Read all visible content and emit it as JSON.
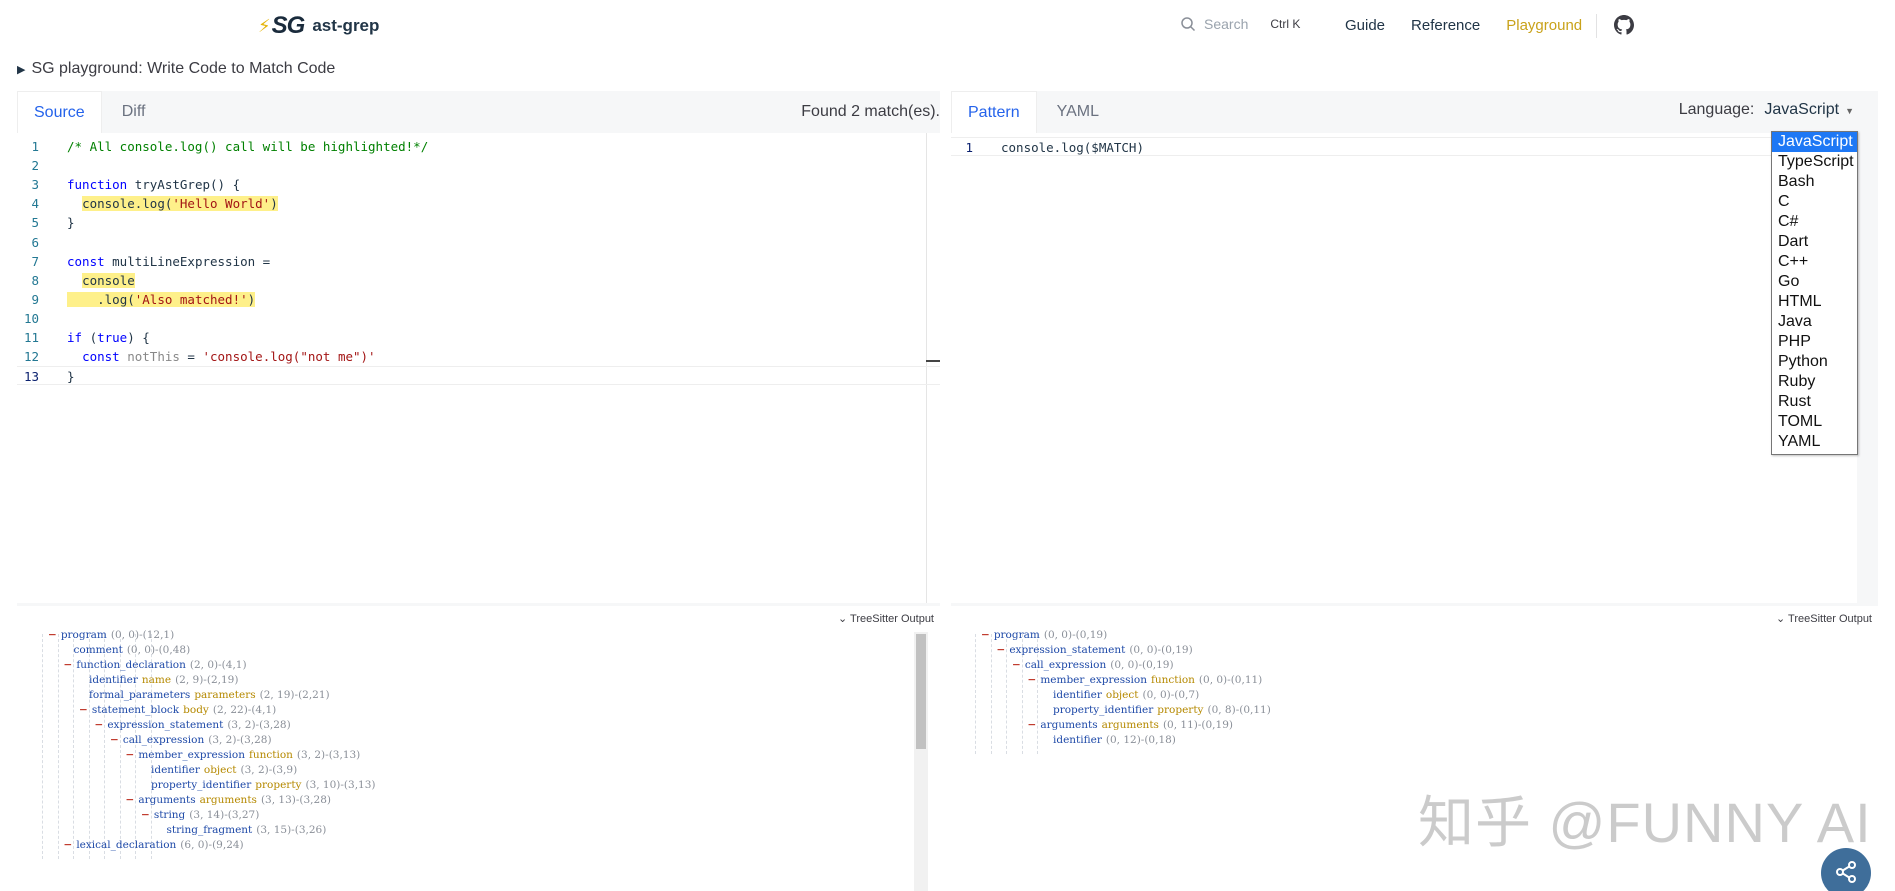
{
  "nav": {
    "logo_mark": "SG",
    "brand": "ast-grep",
    "search_placeholder": "Search",
    "search_shortcut": "Ctrl K",
    "links": [
      {
        "label": "Guide",
        "active": false
      },
      {
        "label": "Reference",
        "active": false
      },
      {
        "label": "Playground",
        "active": true
      }
    ],
    "github_icon": "github-icon"
  },
  "summary": "SG playground: Write Code to Match Code",
  "left": {
    "tabs": [
      "Source",
      "Diff"
    ],
    "active_tab": "Source",
    "found": "Found 2 match(es).",
    "lines": [
      {
        "n": "1",
        "tokens": [
          {
            "t": "/* All console.log() call will be highlighted!*/",
            "c": "comment"
          }
        ]
      },
      {
        "n": "2",
        "tokens": []
      },
      {
        "n": "3",
        "tokens": [
          {
            "t": "function ",
            "c": "kw"
          },
          {
            "t": "tryAstGrep() {",
            "c": "plain"
          }
        ]
      },
      {
        "n": "4",
        "tokens": [
          {
            "t": "  ",
            "c": "plain"
          },
          {
            "t": "console.log(",
            "c": "plain",
            "hl": true
          },
          {
            "t": "'Hello World'",
            "c": "str",
            "hl": true
          },
          {
            "t": ")",
            "c": "plain",
            "hl": true
          }
        ]
      },
      {
        "n": "5",
        "tokens": [
          {
            "t": "}",
            "c": "plain"
          }
        ]
      },
      {
        "n": "6",
        "tokens": []
      },
      {
        "n": "7",
        "tokens": [
          {
            "t": "const ",
            "c": "kw"
          },
          {
            "t": "multiLineExpression =",
            "c": "plain"
          }
        ]
      },
      {
        "n": "8",
        "tokens": [
          {
            "t": "  ",
            "c": "plain"
          },
          {
            "t": "console",
            "c": "plain",
            "hl": true
          }
        ]
      },
      {
        "n": "9",
        "tokens": [
          {
            "t": "  ",
            "c": "plain",
            "hl": true
          },
          {
            "t": "  .log(",
            "c": "plain",
            "hl": true
          },
          {
            "t": "'Also matched!'",
            "c": "str",
            "hl": true
          },
          {
            "t": ")",
            "c": "plain",
            "hl": true
          }
        ]
      },
      {
        "n": "10",
        "tokens": []
      },
      {
        "n": "11",
        "tokens": [
          {
            "t": "if ",
            "c": "kw"
          },
          {
            "t": "(",
            "c": "plain"
          },
          {
            "t": "true",
            "c": "kw"
          },
          {
            "t": ") {",
            "c": "plain"
          }
        ]
      },
      {
        "n": "12",
        "tokens": [
          {
            "t": "  ",
            "c": "plain"
          },
          {
            "t": "const ",
            "c": "kw"
          },
          {
            "t": "notThis",
            "c": "muted"
          },
          {
            "t": " = ",
            "c": "plain"
          },
          {
            "t": "'console.log(\"not me\")'",
            "c": "str"
          }
        ]
      },
      {
        "n": "13",
        "tokens": [
          {
            "t": "}",
            "c": "plain"
          }
        ]
      }
    ],
    "tree_title": "TreeSitter Output",
    "tree": [
      {
        "d": 0,
        "tog": "−",
        "kind": "program",
        "field": "",
        "range": "(0, 0)-(12,1)"
      },
      {
        "d": 1,
        "tog": "",
        "kind": "comment",
        "field": "",
        "range": "(0, 0)-(0,48)"
      },
      {
        "d": 1,
        "tog": "−",
        "kind": "function_declaration",
        "field": "",
        "range": "(2, 0)-(4,1)"
      },
      {
        "d": 2,
        "tog": "",
        "kind": "identifier",
        "field": "name",
        "range": "(2, 9)-(2,19)"
      },
      {
        "d": 2,
        "tog": "",
        "kind": "formal_parameters",
        "field": "parameters",
        "range": "(2, 19)-(2,21)"
      },
      {
        "d": 2,
        "tog": "−",
        "kind": "statement_block",
        "field": "body",
        "range": "(2, 22)-(4,1)"
      },
      {
        "d": 3,
        "tog": "−",
        "kind": "expression_statement",
        "field": "",
        "range": "(3, 2)-(3,28)"
      },
      {
        "d": 4,
        "tog": "−",
        "kind": "call_expression",
        "field": "",
        "range": "(3, 2)-(3,28)"
      },
      {
        "d": 5,
        "tog": "−",
        "kind": "member_expression",
        "field": "function",
        "range": "(3, 2)-(3,13)"
      },
      {
        "d": 6,
        "tog": "",
        "kind": "identifier",
        "field": "object",
        "range": "(3, 2)-(3,9)"
      },
      {
        "d": 6,
        "tog": "",
        "kind": "property_identifier",
        "field": "property",
        "range": "(3, 10)-(3,13)"
      },
      {
        "d": 5,
        "tog": "−",
        "kind": "arguments",
        "field": "arguments",
        "range": "(3, 13)-(3,28)"
      },
      {
        "d": 6,
        "tog": "−",
        "kind": "string",
        "field": "",
        "range": "(3, 14)-(3,27)"
      },
      {
        "d": 7,
        "tog": "",
        "kind": "string_fragment",
        "field": "",
        "range": "(3, 15)-(3,26)"
      },
      {
        "d": 1,
        "tog": "−",
        "kind": "lexical_declaration",
        "field": "",
        "range": "(6, 0)-(9,24)"
      }
    ]
  },
  "right": {
    "tabs": [
      "Pattern",
      "YAML"
    ],
    "active_tab": "Pattern",
    "language_label": "Language:",
    "language_value": "JavaScript",
    "lines": [
      {
        "n": "1",
        "tokens": [
          {
            "t": "console.log($MATCH)",
            "c": "plain"
          }
        ]
      }
    ],
    "tree_title": "TreeSitter Output",
    "tree": [
      {
        "d": 0,
        "tog": "−",
        "kind": "program",
        "field": "",
        "range": "(0, 0)-(0,19)"
      },
      {
        "d": 1,
        "tog": "−",
        "kind": "expression_statement",
        "field": "",
        "range": "(0, 0)-(0,19)"
      },
      {
        "d": 2,
        "tog": "−",
        "kind": "call_expression",
        "field": "",
        "range": "(0, 0)-(0,19)"
      },
      {
        "d": 3,
        "tog": "−",
        "kind": "member_expression",
        "field": "function",
        "range": "(0, 0)-(0,11)"
      },
      {
        "d": 4,
        "tog": "",
        "kind": "identifier",
        "field": "object",
        "range": "(0, 0)-(0,7)"
      },
      {
        "d": 4,
        "tog": "",
        "kind": "property_identifier",
        "field": "property",
        "range": "(0, 8)-(0,11)"
      },
      {
        "d": 3,
        "tog": "−",
        "kind": "arguments",
        "field": "arguments",
        "range": "(0, 11)-(0,19)"
      },
      {
        "d": 4,
        "tog": "",
        "kind": "identifier",
        "field": "",
        "range": "(0, 12)-(0,18)"
      }
    ]
  },
  "language_options": [
    "JavaScript",
    "TypeScript",
    "Bash",
    "C",
    "C#",
    "Dart",
    "C++",
    "Go",
    "HTML",
    "Java",
    "PHP",
    "Python",
    "Ruby",
    "Rust",
    "TOML",
    "YAML"
  ],
  "watermark": "知乎 @FUNNY AI",
  "share_icon": "share-icon",
  "colors": {
    "accent": "#2563eb",
    "active_nav": "#c9a21a",
    "match_highlight": "#fef08a",
    "dropdown_selected": "#1e78f5"
  }
}
